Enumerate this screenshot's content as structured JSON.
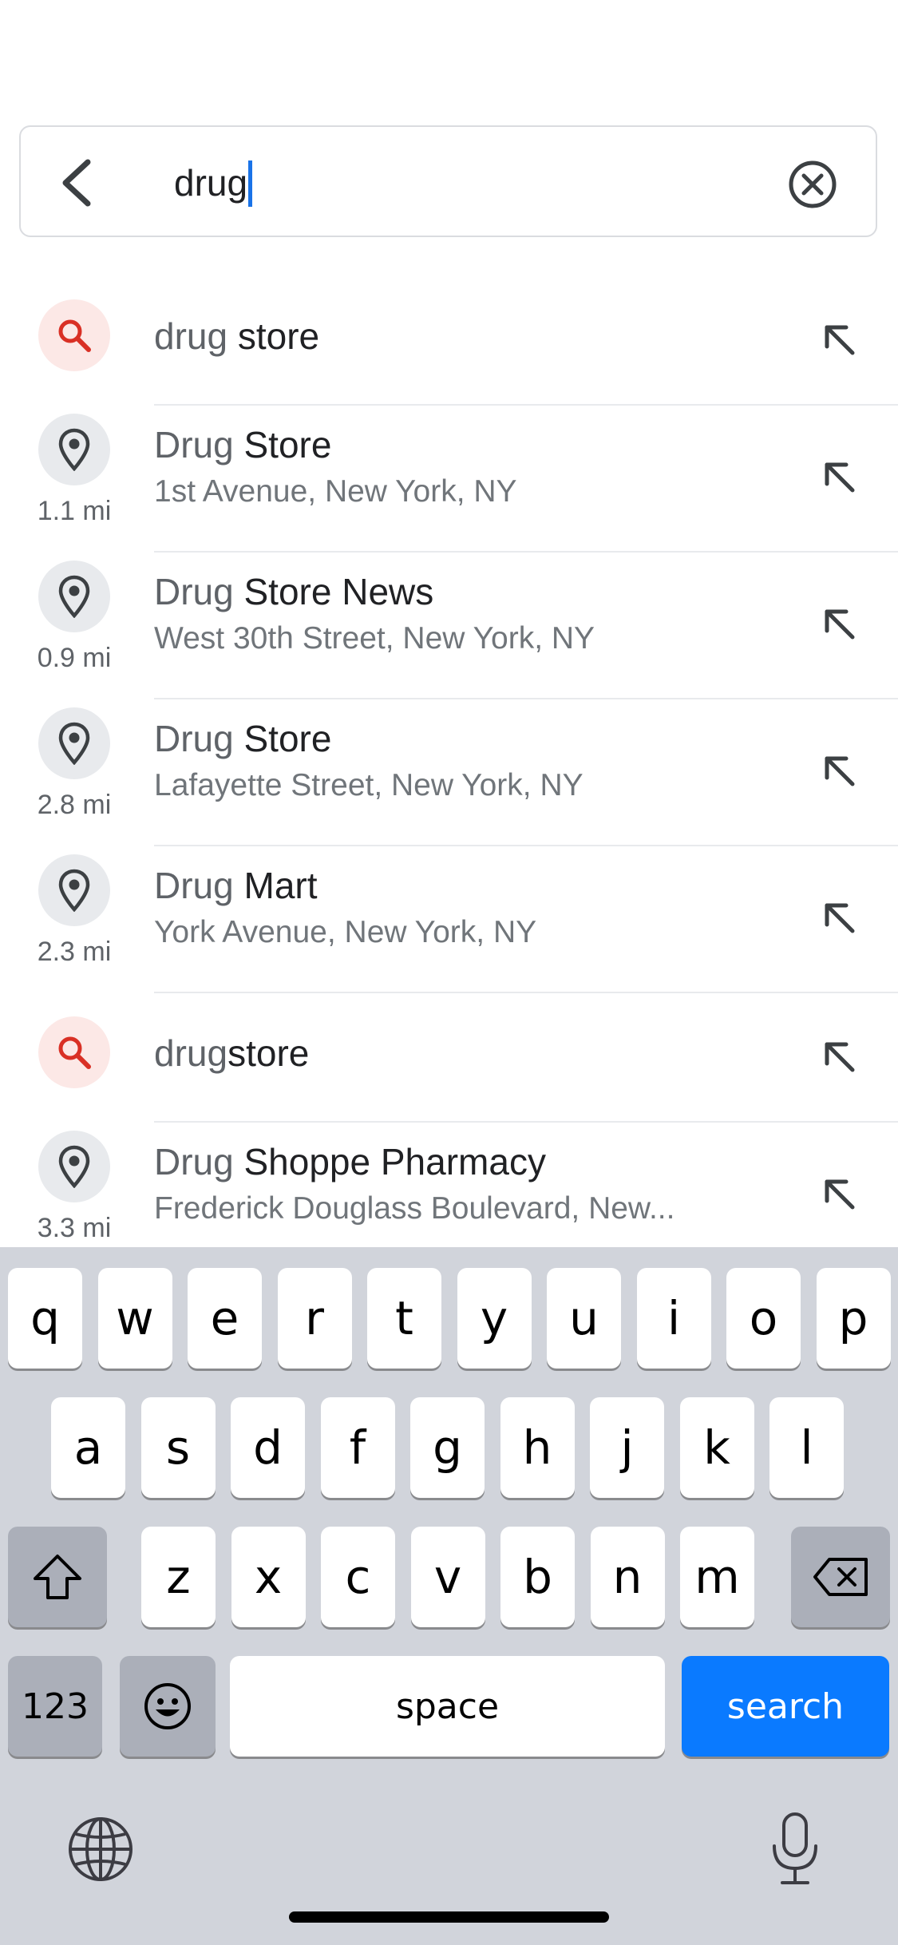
{
  "search": {
    "query": "drug"
  },
  "results": [
    {
      "type": "search",
      "prefix": "drug",
      "rest": " store",
      "subtitle": null,
      "distance": null
    },
    {
      "type": "place",
      "prefix": "Drug",
      "rest": " Store",
      "subtitle": "1st Avenue, New York, NY",
      "distance": "1.1 mi"
    },
    {
      "type": "place",
      "prefix": "Drug",
      "rest": " Store News",
      "subtitle": "West 30th Street, New York, NY",
      "distance": "0.9 mi"
    },
    {
      "type": "place",
      "prefix": "Drug",
      "rest": " Store",
      "subtitle": "Lafayette Street, New York, NY",
      "distance": "2.8 mi"
    },
    {
      "type": "place",
      "prefix": "Drug",
      "rest": " Mart",
      "subtitle": "York Avenue, New York, NY",
      "distance": "2.3 mi"
    },
    {
      "type": "search",
      "prefix": "drug",
      "rest": "store",
      "subtitle": null,
      "distance": null
    },
    {
      "type": "place",
      "prefix": "Drug",
      "rest": " Shoppe Pharmacy",
      "subtitle": "Frederick Douglass Boulevard, New...",
      "distance": "3.3 mi"
    }
  ],
  "keyboard": {
    "row1": [
      "q",
      "w",
      "e",
      "r",
      "t",
      "y",
      "u",
      "i",
      "o",
      "p"
    ],
    "row2": [
      "a",
      "s",
      "d",
      "f",
      "g",
      "h",
      "j",
      "k",
      "l"
    ],
    "row3": [
      "z",
      "x",
      "c",
      "v",
      "b",
      "n",
      "m"
    ],
    "numbers_label": "123",
    "space_label": "space",
    "search_label": "search"
  },
  "colors": {
    "accent": "#0a7aff",
    "search_icon": "#d93025",
    "caret": "#1a73e8"
  }
}
